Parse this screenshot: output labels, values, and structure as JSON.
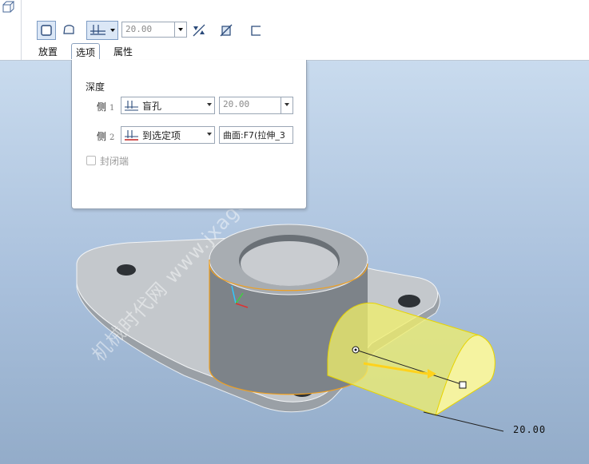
{
  "dashboard": {
    "depth_value": "20.00",
    "tabs": [
      {
        "label": "放置"
      },
      {
        "label": "选项"
      },
      {
        "label": "属性"
      }
    ]
  },
  "options_panel": {
    "depth_heading": "深度",
    "side1": {
      "label": "侧",
      "index": "1",
      "depth_type": "盲孔",
      "depth_value": "20.00"
    },
    "side2": {
      "label": "侧",
      "index": "2",
      "depth_type": "到选定项",
      "reference": "曲面:F7(拉伸_3"
    },
    "capped_ends": {
      "label": "封闭端",
      "checked": false,
      "enabled": false
    }
  },
  "model": {
    "dimension_value": "20.00"
  },
  "watermark": "机械时代网 www.jxage.com",
  "colors": {
    "preview_yellow": "#f2f06a",
    "edge_orange": "#f0a020",
    "model_gray": "#8f949a"
  }
}
